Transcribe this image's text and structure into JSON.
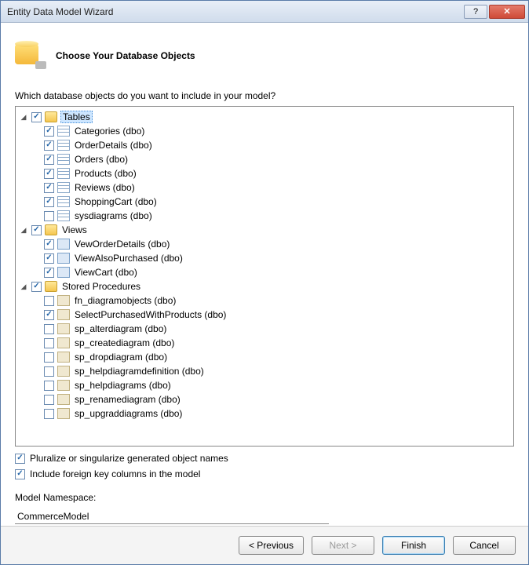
{
  "window": {
    "title": "Entity Data Model Wizard"
  },
  "header": {
    "title": "Choose Your Database Objects"
  },
  "prompt": "Which database objects do you want to include in your model?",
  "tree": {
    "tables": {
      "label": "Tables",
      "items": [
        {
          "label": "Categories (dbo)",
          "checked": true
        },
        {
          "label": "OrderDetails (dbo)",
          "checked": true
        },
        {
          "label": "Orders (dbo)",
          "checked": true
        },
        {
          "label": "Products (dbo)",
          "checked": true
        },
        {
          "label": "Reviews (dbo)",
          "checked": true
        },
        {
          "label": "ShoppingCart (dbo)",
          "checked": true
        },
        {
          "label": "sysdiagrams (dbo)",
          "checked": false
        }
      ]
    },
    "views": {
      "label": "Views",
      "items": [
        {
          "label": "VewOrderDetails (dbo)",
          "checked": true
        },
        {
          "label": "ViewAlsoPurchased (dbo)",
          "checked": true
        },
        {
          "label": "ViewCart (dbo)",
          "checked": true
        }
      ]
    },
    "procs": {
      "label": "Stored Procedures",
      "items": [
        {
          "label": "fn_diagramobjects (dbo)",
          "checked": false
        },
        {
          "label": "SelectPurchasedWithProducts (dbo)",
          "checked": true
        },
        {
          "label": "sp_alterdiagram (dbo)",
          "checked": false
        },
        {
          "label": "sp_creatediagram (dbo)",
          "checked": false
        },
        {
          "label": "sp_dropdiagram (dbo)",
          "checked": false
        },
        {
          "label": "sp_helpdiagramdefinition (dbo)",
          "checked": false
        },
        {
          "label": "sp_helpdiagrams (dbo)",
          "checked": false
        },
        {
          "label": "sp_renamediagram (dbo)",
          "checked": false
        },
        {
          "label": "sp_upgraddiagrams (dbo)",
          "checked": false
        }
      ]
    }
  },
  "options": {
    "pluralize": "Pluralize or singularize generated object names",
    "fk": "Include foreign key columns in the model"
  },
  "namespace": {
    "label": "Model Namespace:",
    "value": "CommerceModel"
  },
  "buttons": {
    "previous": "< Previous",
    "next": "Next >",
    "finish": "Finish",
    "cancel": "Cancel"
  }
}
